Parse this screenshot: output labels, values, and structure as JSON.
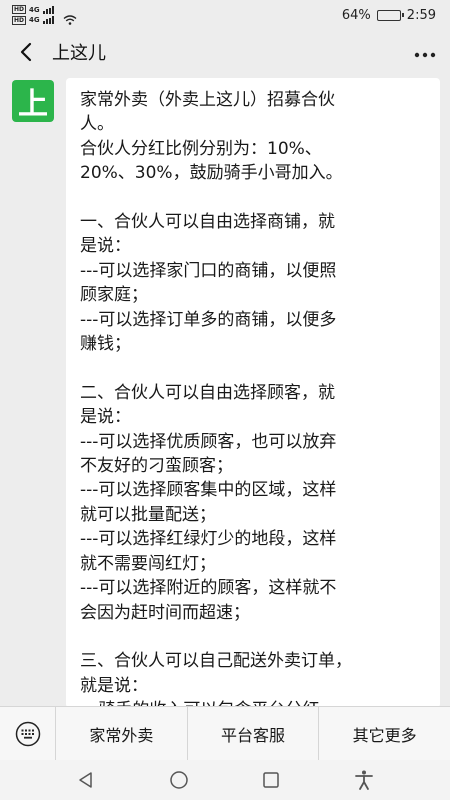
{
  "status_bar": {
    "sim1_badge": "HD",
    "sim1_net": "4G",
    "sim2_badge": "HD",
    "sim2_net": "4G",
    "battery_text": "64%",
    "battery_level": 0.64,
    "time": "2:59"
  },
  "header": {
    "title": "上这儿",
    "back_icon": "chevron-left-icon",
    "more_icon": "more-dots-icon"
  },
  "chat": {
    "avatar_text": "上",
    "avatar_color": "#2cb54b",
    "message_lines": [
      "家常外卖（外卖上这儿）招募合伙",
      "人。",
      "合伙人分红比例分别为：10%、",
      "20%、30%，鼓励骑手小哥加入。",
      "",
      "一、合伙人可以自由选择商铺，就",
      "是说：",
      "---可以选择家门口的商铺，以便照",
      "顾家庭；",
      "---可以选择订单多的商铺，以便多",
      "赚钱；",
      "",
      "二、合伙人可以自由选择顾客，就",
      "是说：",
      "---可以选择优质顾客，也可以放弃",
      "不友好的刁蛮顾客；",
      "---可以选择顾客集中的区域，这样",
      "就可以批量配送；",
      "---可以选择红绿灯少的地段，这样",
      "就不需要闯红灯；",
      "---可以选择附近的顾客，这样就不",
      "会因为赶时间而超速；",
      "",
      "三、合伙人可以自己配送外卖订单，",
      "就是说：",
      "---骑手的收入可以包含平台分红"
    ]
  },
  "bottom_menu": {
    "keyboard_icon": "keyboard-icon",
    "items": [
      "家常外卖",
      "平台客服",
      "其它更多"
    ]
  },
  "system_nav": {
    "icons": [
      "back-triangle-icon",
      "home-circle-icon",
      "recents-square-icon",
      "accessibility-icon"
    ]
  }
}
